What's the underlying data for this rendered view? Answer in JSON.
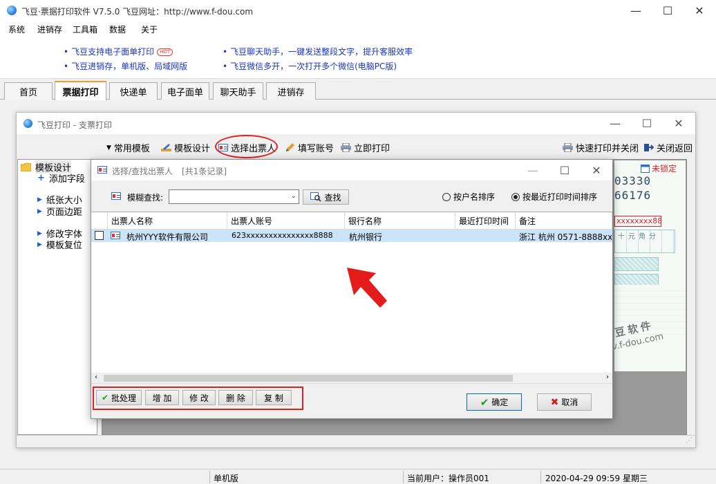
{
  "app": {
    "title": "飞豆·票据打印软件 V7.5.0   飞豆网址：http://www.f-dou.com",
    "window_controls": {
      "minimize": "—",
      "maximize": "☐",
      "close": "✕"
    }
  },
  "menu": [
    "系统",
    "进销存",
    "工具箱",
    "数据",
    "关于"
  ],
  "ads": [
    {
      "text": "飞豆支持电子面单打印",
      "badge": "HOT"
    },
    {
      "text": "飞豆进销存，单机版、局域网版"
    },
    {
      "text": "飞豆聊天助手，一键发送整段文字，提升客服效率"
    },
    {
      "text": "飞豆微信多开，一次打开多个微信(电脑PC版)"
    }
  ],
  "tabs": [
    {
      "label": "首页",
      "active": false
    },
    {
      "label": "票据打印",
      "active": true
    },
    {
      "label": "快递单",
      "active": false
    },
    {
      "label": "电子面单",
      "active": false
    },
    {
      "label": "聊天助手",
      "active": false
    },
    {
      "label": "进销存",
      "active": false
    }
  ],
  "inner_window": {
    "title": "飞豆打印 - 支票打印",
    "toolbar": {
      "common_templates": "常用模板",
      "template_design": "模板设计",
      "select_drawer": "选择出票人",
      "fill_account": "填写账号",
      "print_now": "立即打印",
      "quick_print_close": "快速打印并关闭",
      "close_return": "关闭返回"
    },
    "sidebar": {
      "root": "模板设计",
      "items": [
        "添加字段",
        "纸张大小",
        "页面边距",
        "修改字体",
        "模板复位"
      ]
    },
    "lock_status": "未锁定",
    "ticket_fragments": {
      "number1": "03330",
      "number2": "66176",
      "account_mask": "xxxxxxxx88",
      "units": "十元角分",
      "watermark1": "豆软件",
      "watermark2": "v.f-dou.com"
    }
  },
  "dialog": {
    "title": "选择/查找出票人",
    "record_count": "[共1条记录]",
    "search_label": "模糊查找:",
    "search_value": "",
    "search_button": "查找",
    "sort_options": [
      {
        "label": "按户名排序",
        "selected": false
      },
      {
        "label": "按最近打印时间排序",
        "selected": true
      }
    ],
    "columns": [
      "出票人名称",
      "出票人账号",
      "银行名称",
      "最近打印时间",
      "备注"
    ],
    "rows": [
      {
        "checked": false,
        "name": "杭州YYY软件有限公司",
        "account": "623xxxxxxxxxxxxxxx8888",
        "bank": "杭州银行",
        "last_print": "",
        "note": "浙江 杭州 0571-8888xxx"
      }
    ],
    "action_buttons": [
      "批处理",
      "增 加",
      "修 改",
      "删 除",
      "复 制"
    ],
    "ok_button": "确定",
    "cancel_button": "取消"
  },
  "statusbar": {
    "edition": "单机版",
    "current_user": "当前用户：操作员001",
    "datetime": "2020-04-29 09:59 星期三"
  },
  "colors": {
    "link_blue": "#1a35c9",
    "highlight_red": "#e02020",
    "selection": "#cce4f7",
    "tab_accent": "#f39a2b"
  }
}
